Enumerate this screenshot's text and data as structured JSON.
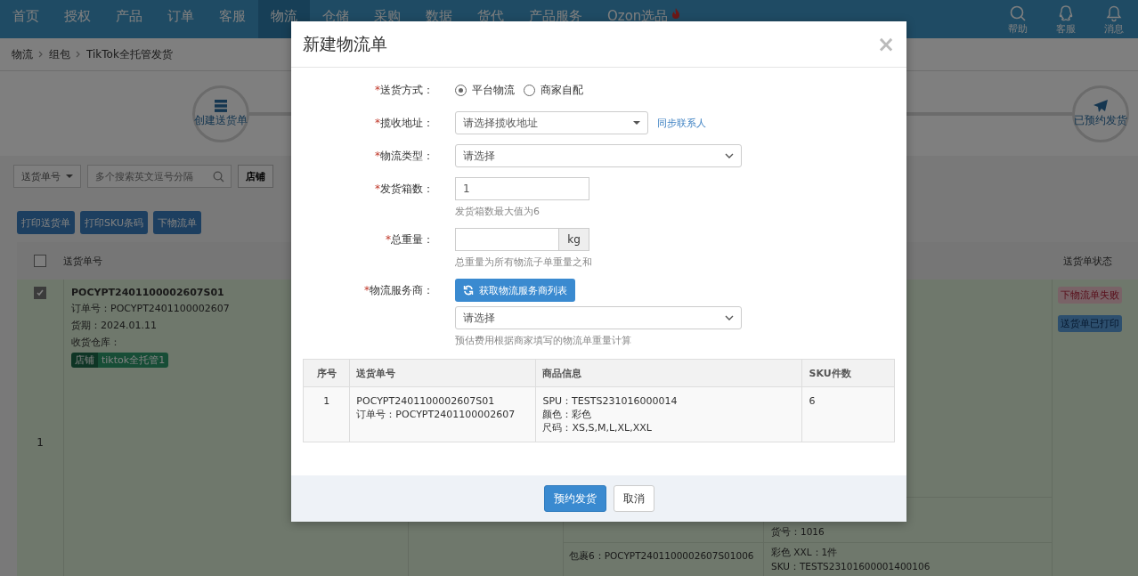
{
  "nav": {
    "items": [
      {
        "label": "首页",
        "selected": false
      },
      {
        "label": "授权",
        "selected": false
      },
      {
        "label": "产品",
        "selected": false
      },
      {
        "label": "订单",
        "selected": false
      },
      {
        "label": "客服",
        "selected": false
      },
      {
        "label": "物流",
        "selected": true
      },
      {
        "label": "仓储",
        "selected": false
      },
      {
        "label": "采购",
        "selected": false
      },
      {
        "label": "数据",
        "selected": false
      },
      {
        "label": "货代",
        "selected": false
      },
      {
        "label": "产品服务",
        "selected": false
      },
      {
        "label": "Ozon选品",
        "selected": false,
        "hot": true
      }
    ],
    "tools": [
      {
        "kind": "search",
        "label": "帮助"
      },
      {
        "kind": "chat",
        "label": "客服"
      },
      {
        "kind": "bell",
        "label": "消息"
      }
    ]
  },
  "breadcrumb": [
    "物流",
    "组包",
    "TikTok全托管发货"
  ],
  "steps": [
    {
      "label": "创建送货单",
      "kind": "create"
    },
    {
      "label": "已预约发货",
      "kind": "send"
    }
  ],
  "filter": {
    "dropdown": "送货单号",
    "search_placeholder": "多个搜索英文逗号分隔",
    "shop_button": "店铺"
  },
  "actions": [
    "打印送货单",
    "打印SKU条码",
    "下物流单"
  ],
  "table": {
    "columns": [
      "送货单号",
      "送货单状态"
    ],
    "all_checked": false,
    "row": {
      "checked": true,
      "index": "1",
      "shipment_no": "POCYPT2401100002607S01",
      "lines": [
        "订单号：POCYPT2401100002607",
        "货期：2024.01.11",
        "收货仓库："
      ],
      "tag": {
        "label": "店铺",
        "value": "tiktok全托管1"
      },
      "statuses": [
        {
          "label": "下物流单失败",
          "kind": "danger"
        },
        {
          "label": "送货单已打印",
          "kind": "info"
        }
      ],
      "packages": [
        {
          "lines": [
            "货号：1016"
          ]
        },
        {
          "label": "包裹6：POCYPT2401100002607S01006",
          "lines": [
            "彩色 XXL：1件",
            "SKU：TESTS23101600001400106"
          ]
        }
      ]
    }
  },
  "modal": {
    "title": "新建物流单",
    "close": "×",
    "fields": [
      {
        "kind": "radio",
        "mark": "*",
        "label": "送货方式：",
        "options": [
          {
            "label": "平台物流",
            "selected": true
          },
          {
            "label": "商家自配",
            "selected": false
          }
        ]
      },
      {
        "kind": "address",
        "mark": "*",
        "label": "揽收地址：",
        "placeholder": "请选择揽收地址",
        "link": "同步联系人"
      },
      {
        "kind": "select",
        "mark": "*",
        "label": "物流类型：",
        "placeholder": "请选择"
      },
      {
        "kind": "number",
        "mark": "*",
        "label": "发货箱数：",
        "value": "1",
        "help": "发货箱数最大值为6"
      },
      {
        "kind": "unit",
        "mark": "*",
        "label": "总重量：",
        "unit": "kg",
        "help": "总重量为所有物流子单重量之和"
      },
      {
        "kind": "provider",
        "mark": "*",
        "label": "物流服务商：",
        "button": "获取物流服务商列表",
        "placeholder": "请选择",
        "help": "预估费用根据商家填写的物流单重量计算"
      }
    ],
    "table": {
      "columns": [
        "序号",
        "送货单号",
        "商品信息",
        "SKU件数"
      ],
      "rows": [
        {
          "cells": [
            [
              "1"
            ],
            [
              "POCYPT2401100002607S01",
              "订单号：POCYPT2401100002607"
            ],
            [
              "SPU：TESTS231016000014",
              "颜色：彩色",
              "尺码：XS,S,M,L,XL,XXL"
            ],
            [
              "6"
            ]
          ]
        }
      ]
    },
    "buttons": [
      {
        "label": "预约发货",
        "kind": "primary"
      },
      {
        "label": "取消",
        "kind": "default"
      }
    ]
  }
}
